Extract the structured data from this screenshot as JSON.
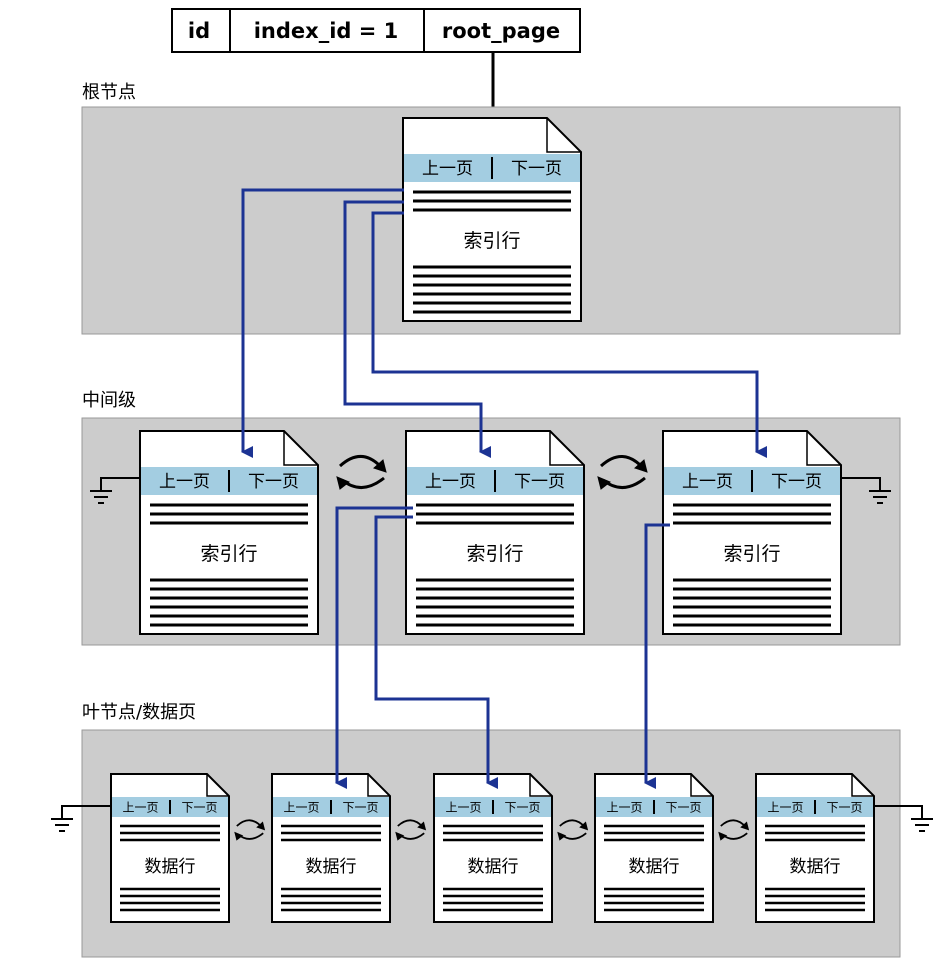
{
  "header": {
    "cells": [
      "id",
      "index_id = 1",
      "root_page"
    ]
  },
  "levels": {
    "root": "根节点",
    "intermediate": "中间级",
    "leaf": "叶节点/数据页"
  },
  "pages": {
    "prev_label": "上一页",
    "next_label": "下一页",
    "index_row_label": "索引行",
    "data_row_label": "数据行"
  },
  "colors": {
    "level_fill": "#cccccc",
    "nav_band": "#a3cde1",
    "pointer_line": "#1c3393",
    "page_fill": "#ffffff"
  }
}
